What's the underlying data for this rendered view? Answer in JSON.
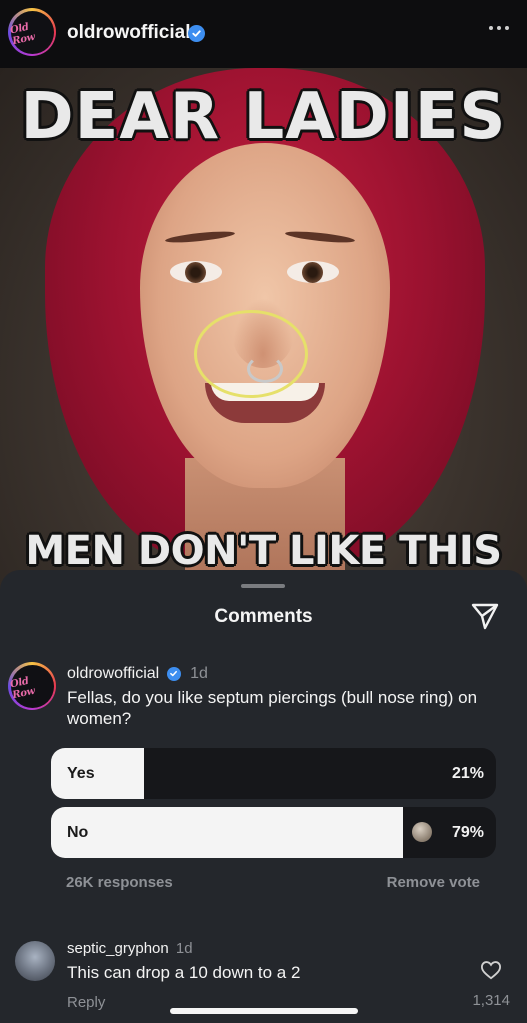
{
  "post": {
    "username": "oldrowofficial",
    "verified": true,
    "avatar_logo_text": "Old Row",
    "more_icon": "more-horizontal-icon",
    "image": {
      "top_text": "DEAR LADIES",
      "bottom_text": "MEN DON'T LIKE THIS"
    }
  },
  "comments_sheet": {
    "title": "Comments",
    "share_icon": "send-icon",
    "main_comment": {
      "username": "oldrowofficial",
      "verified": true,
      "time": "1d",
      "text": "Fellas, do you like septum piercings (bull nose ring) on women?",
      "poll": {
        "options": [
          {
            "label": "Yes",
            "percent_label": "21%",
            "fraction": 0.21,
            "selected": false
          },
          {
            "label": "No",
            "percent_label": "79%",
            "fraction": 0.79,
            "selected": true
          }
        ],
        "responses": "26K responses",
        "remove_vote_label": "Remove vote"
      }
    },
    "reply_comment": {
      "username": "septic_gryphon",
      "time": "1d",
      "text": "This can drop a 10 down to a 2",
      "reply_label": "Reply",
      "like_count": "1,314",
      "like_icon": "heart-icon"
    }
  },
  "colors": {
    "sheet_background": "#24272c",
    "poll_fill": "#f4f4f4",
    "verified_badge": "#3d8ef0",
    "highlight_circle": "#e6e06a"
  }
}
